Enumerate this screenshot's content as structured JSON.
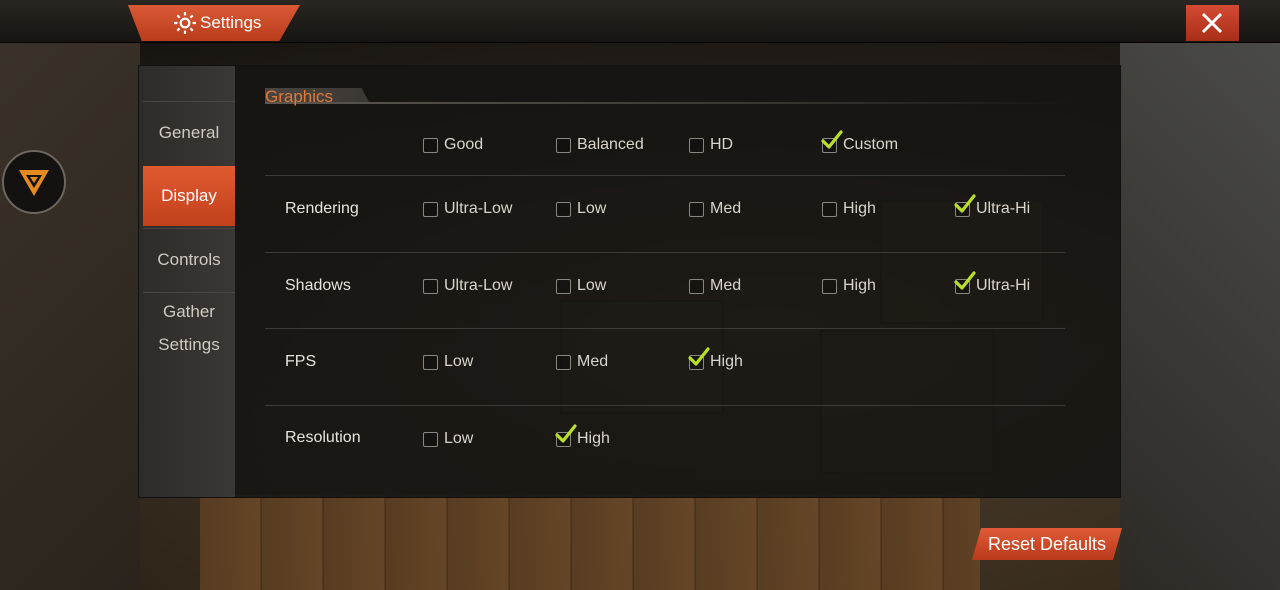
{
  "window": {
    "title": "Settings"
  },
  "sidebar": {
    "tabs": [
      {
        "label": "General"
      },
      {
        "label": "Display"
      },
      {
        "label": "Controls"
      },
      {
        "label_line1": "Gather",
        "label_line2": "Settings"
      }
    ],
    "active": "Display"
  },
  "graphics": {
    "title": "Graphics",
    "presets": [
      {
        "label": "Good",
        "checked": false
      },
      {
        "label": "Balanced",
        "checked": false
      },
      {
        "label": "HD",
        "checked": false
      },
      {
        "label": "Custom",
        "checked": true
      }
    ],
    "rows": [
      {
        "label": "Rendering",
        "options": [
          {
            "label": "Ultra-Low",
            "checked": false
          },
          {
            "label": "Low",
            "checked": false
          },
          {
            "label": "Med",
            "checked": false
          },
          {
            "label": "High",
            "checked": false
          },
          {
            "label": "Ultra-Hi",
            "checked": true
          }
        ]
      },
      {
        "label": "Shadows",
        "options": [
          {
            "label": "Ultra-Low",
            "checked": false
          },
          {
            "label": "Low",
            "checked": false
          },
          {
            "label": "Med",
            "checked": false
          },
          {
            "label": "High",
            "checked": false
          },
          {
            "label": "Ultra-Hi",
            "checked": true
          }
        ]
      },
      {
        "label": "FPS",
        "options": [
          {
            "label": "Low",
            "checked": false
          },
          {
            "label": "Med",
            "checked": false
          },
          {
            "label": "High",
            "checked": true
          }
        ]
      },
      {
        "label": "Resolution",
        "options": [
          {
            "label": "Low",
            "checked": false
          },
          {
            "label": "High",
            "checked": true
          }
        ]
      }
    ]
  },
  "footer": {
    "reset_label": "Reset Defaults"
  },
  "colors": {
    "accent": "#d9532c",
    "check": "#b8e02a",
    "section_title": "#e07a3a"
  },
  "icons": {
    "title": "gear-icon",
    "close": "close-icon",
    "side": "triangle-badge-icon",
    "check": "checkmark-icon"
  }
}
